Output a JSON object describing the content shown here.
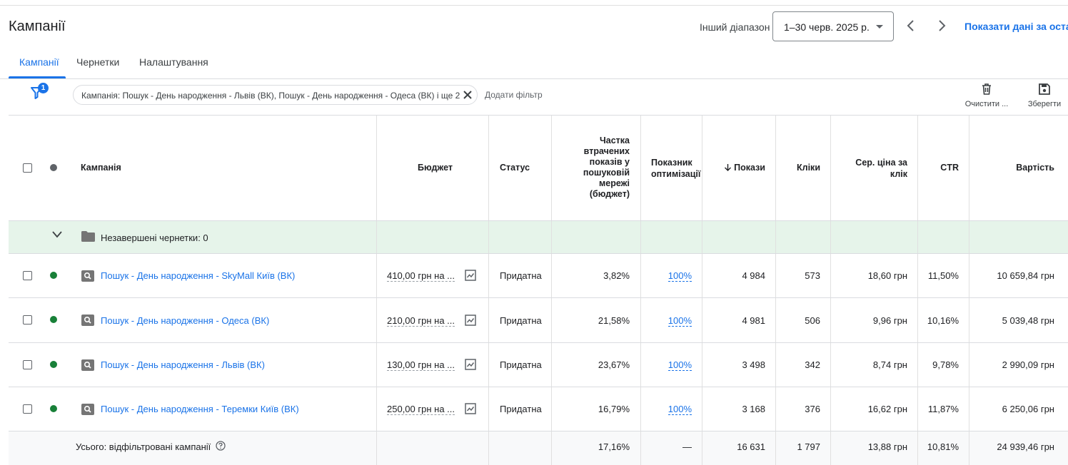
{
  "header": {
    "title": "Кампанії",
    "range_label": "Інший діапазон",
    "date_range": "1–30 черв. 2025 р.",
    "show_data_link": "Показати дані за останн"
  },
  "tabs": [
    {
      "label": "Кампанії",
      "active": true
    },
    {
      "label": "Чернетки",
      "active": false
    },
    {
      "label": "Налаштування",
      "active": false
    }
  ],
  "filters": {
    "badge_count": "1",
    "chip_text": "Кампанія: Пошук - День народження - Львів (ВК), Пошук - День народження - Одеса (ВК) і ще 2",
    "add_filter": "Додати фільтр"
  },
  "toolbar": {
    "clear_label": "Очистити ...",
    "save_label": "Зберегти"
  },
  "table": {
    "columns": {
      "campaign": "Кампанія",
      "budget": "Бюджет",
      "status": "Статус",
      "lost_is": "Частка втрачених показів у пошуковій мережі (бюджет)",
      "opt_score": "Показник оптимізації",
      "impressions": "Покази",
      "clicks": "Кліки",
      "avg_cpc": "Сер. ціна за клік",
      "ctr": "CTR",
      "cost": "Вартість"
    },
    "sort_icon": "arrow-down-icon",
    "drafts_row": "Незавершені чернетки: 0",
    "rows": [
      {
        "campaign": "Пошук - День народження - SkyMall Київ (ВК)",
        "budget": "410,00 грн на ...",
        "status": "Придатна",
        "lost_is": "3,82%",
        "opt_score": "100%",
        "impressions": "4 984",
        "clicks": "573",
        "avg_cpc": "18,60 грн",
        "ctr": "11,50%",
        "cost": "10 659,84 грн"
      },
      {
        "campaign": "Пошук - День народження - Одеса (ВК)",
        "budget": "210,00 грн на ...",
        "status": "Придатна",
        "lost_is": "21,58%",
        "opt_score": "100%",
        "impressions": "4 981",
        "clicks": "506",
        "avg_cpc": "9,96 грн",
        "ctr": "10,16%",
        "cost": "5 039,48 грн"
      },
      {
        "campaign": "Пошук - День народження - Львів (ВК)",
        "budget": "130,00 грн на ...",
        "status": "Придатна",
        "lost_is": "23,67%",
        "opt_score": "100%",
        "impressions": "3 498",
        "clicks": "342",
        "avg_cpc": "8,74 грн",
        "ctr": "9,78%",
        "cost": "2 990,09 грн"
      },
      {
        "campaign": "Пошук - День народження - Теремки Київ (ВК)",
        "budget": "250,00 грн на ...",
        "status": "Придатна",
        "lost_is": "16,79%",
        "opt_score": "100%",
        "impressions": "3 168",
        "clicks": "376",
        "avg_cpc": "16,62 грн",
        "ctr": "11,87%",
        "cost": "6 250,06 грн"
      }
    ],
    "total": {
      "label": "Усього: відфільтровані кампанії",
      "lost_is": "17,16%",
      "opt_score": "—",
      "impressions": "16 631",
      "clicks": "1 797",
      "avg_cpc": "13,88 грн",
      "ctr": "10,81%",
      "cost": "24 939,46 грн"
    }
  },
  "colors": {
    "accent": "#1a73e8",
    "status_enabled": "#188038",
    "drafts_bg": "#e6f4ea"
  }
}
